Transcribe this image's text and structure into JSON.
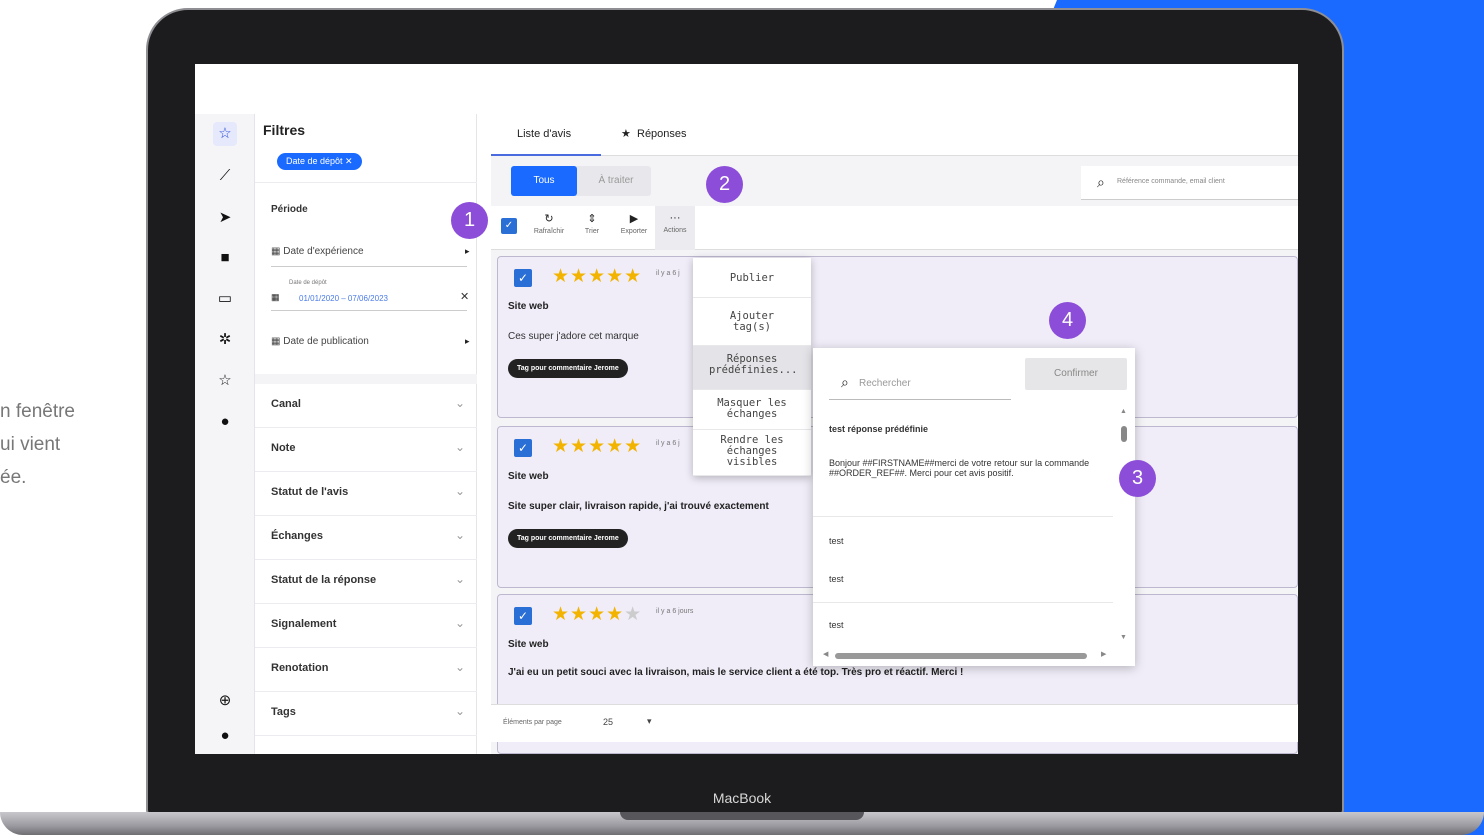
{
  "side_text": [
    "n fenêtre",
    "ui vient",
    "ée."
  ],
  "laptop": {
    "brand": "MacBook"
  },
  "app": {
    "nav_icons": [
      "star-icon",
      "chart-icon",
      "send-icon",
      "lock-icon",
      "monitor-icon",
      "gear-icon",
      "star-outline-icon",
      "help-icon",
      "globe-icon",
      "help-icon"
    ],
    "filters": {
      "title": "Filtres",
      "active_chip": "Date de dépôt ✕",
      "period_label": "Période",
      "date_experience": "Date d'expérience",
      "date_depot_label": "Date de dépôt",
      "date_depot_value": "01/01/2020 – 07/06/2023",
      "date_publication": "Date de publication",
      "sections": [
        "Canal",
        "Note",
        "Statut de l'avis",
        "Échanges",
        "Statut de la réponse",
        "Signalement",
        "Renotation",
        "Tags"
      ]
    },
    "tabs": [
      "Liste d'avis",
      "Réponses"
    ],
    "segments": [
      "Tous",
      "À traiter"
    ],
    "search_placeholder": "Référence commande, email client",
    "toolbar": [
      "Rafraîchir",
      "Trier",
      "Exporter",
      "Actions"
    ],
    "actions_menu": [
      "Publier",
      "Ajouter tag(s)",
      "Réponses prédéfinies...",
      "Masquer les échanges",
      "Rendre les échanges visibles"
    ],
    "reviews": [
      {
        "rating": 5,
        "time": "il y a 6 j",
        "source": "Site web",
        "text": "Ces super j'adore cet marque",
        "tag": "Tag pour commentaire Jerome"
      },
      {
        "rating": 5,
        "time": "il y a 6 j",
        "source": "Site web",
        "text": "Site super clair, livraison rapide, j'ai trouvé exactement",
        "tag": "Tag pour commentaire Jerome"
      },
      {
        "rating": 4,
        "time": "il y a 6 jours",
        "source": "Site web",
        "text": "J'ai eu un petit souci avec la livraison, mais le service client a été top. Très pro et réactif. Merci !",
        "tag": ""
      }
    ],
    "pagination": {
      "label": "Éléments par page",
      "value": "25"
    },
    "popup": {
      "search_placeholder": "Rechercher",
      "confirm": "Confirmer",
      "items": [
        "test réponse prédéfinie",
        "Bonjour ##FIRSTNAME##merci de votre retour sur la commande ##ORDER_REF##. Merci pour cet avis positif.",
        "test",
        "test",
        "test"
      ]
    },
    "badges": [
      "1",
      "2",
      "3",
      "4"
    ]
  },
  "colors": {
    "accent": "#1a6aff",
    "badge": "#8c4ed8",
    "star": "#f2b400",
    "checkbox": "#2a6fd6"
  }
}
